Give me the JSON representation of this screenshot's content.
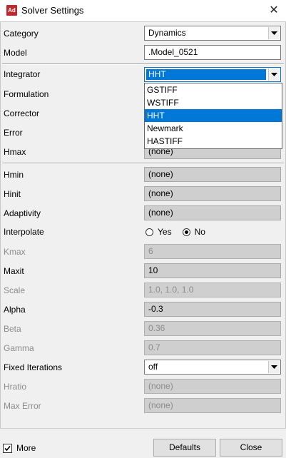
{
  "window": {
    "title": "Solver Settings",
    "icon_text": "Ad",
    "close_glyph": "✕"
  },
  "rows": {
    "category": {
      "label": "Category",
      "value": "Dynamics"
    },
    "model": {
      "label": "Model",
      "value": ".Model_0521"
    },
    "integrator": {
      "label": "Integrator",
      "value": "HHT"
    },
    "formulation": {
      "label": "Formulation"
    },
    "corrector": {
      "label": "Corrector"
    },
    "error": {
      "label": "Error"
    },
    "hmax": {
      "label": "Hmax",
      "value": "(none)"
    },
    "hmin": {
      "label": "Hmin",
      "value": "(none)"
    },
    "hinit": {
      "label": "Hinit",
      "value": "(none)"
    },
    "adaptivity": {
      "label": "Adaptivity",
      "value": "(none)"
    },
    "interpolate": {
      "label": "Interpolate",
      "option_yes": "Yes",
      "option_no": "No",
      "selected": "No"
    },
    "kmax": {
      "label": "Kmax",
      "value": "6"
    },
    "maxit": {
      "label": "Maxit",
      "value": "10"
    },
    "scale": {
      "label": "Scale",
      "value": "1.0, 1.0, 1.0"
    },
    "alpha": {
      "label": "Alpha",
      "value": "-0.3"
    },
    "beta": {
      "label": "Beta",
      "value": "0.36"
    },
    "gamma": {
      "label": "Gamma",
      "value": "0.7"
    },
    "fixed_iterations": {
      "label": "Fixed Iterations",
      "value": "off"
    },
    "hratio": {
      "label": "Hratio",
      "value": "(none)"
    },
    "max_error": {
      "label": "Max Error",
      "value": "(none)"
    }
  },
  "integrator_dropdown": {
    "options": [
      "GSTIFF",
      "WSTIFF",
      "HHT",
      "Newmark",
      "HASTIFF"
    ],
    "selected": "HHT"
  },
  "footer": {
    "more_label": "More",
    "more_checked": true,
    "defaults_label": "Defaults",
    "close_label": "Close"
  },
  "colors": {
    "accent": "#0078d7",
    "panel": "#f0f0f0",
    "readonly_field": "#cfcfcf",
    "disabled_text": "#8c8c8c"
  }
}
